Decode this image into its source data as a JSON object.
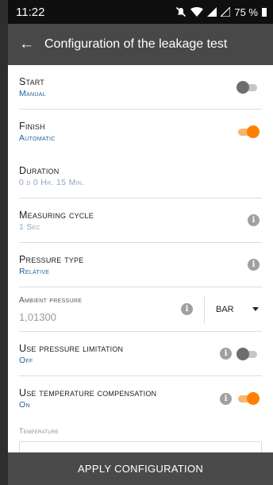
{
  "status_bar": {
    "time": "11:22",
    "battery": "75 %"
  },
  "app_bar": {
    "title": "Configuration of the leakage test"
  },
  "settings": [
    {
      "label": "Start",
      "value": "Manual",
      "toggle": "off",
      "info": false
    },
    {
      "label": "Finish",
      "value": "Automatic",
      "toggle": "on",
      "info": false
    },
    {
      "label": "Duration",
      "value": "0 d 0 Hr. 15 Min.",
      "toggle": null,
      "info": false
    },
    {
      "label": "Measuring cycle",
      "value": "1 Sec",
      "toggle": null,
      "info": true
    },
    {
      "label": "Pressure type",
      "value": "Relative",
      "toggle": null,
      "info": true
    }
  ],
  "ambient_pressure": {
    "label": "Ambient pressure",
    "value": "1,01300",
    "unit": "BAR"
  },
  "pressure_limitation": {
    "label": "Use pressure limitation",
    "value": "Off",
    "toggle": "off"
  },
  "temperature_compensation": {
    "label": "Use temperature compensation",
    "value": "On",
    "toggle": "on"
  },
  "temperature": {
    "label": "Temperature"
  },
  "apply_button": {
    "label": "APPLY CONFIGURATION"
  },
  "colors": {
    "accent": "#ff7f00",
    "value_text": "#1f5f98",
    "app_bar": "#484848",
    "bottom_bar": "#4a4a4a"
  }
}
